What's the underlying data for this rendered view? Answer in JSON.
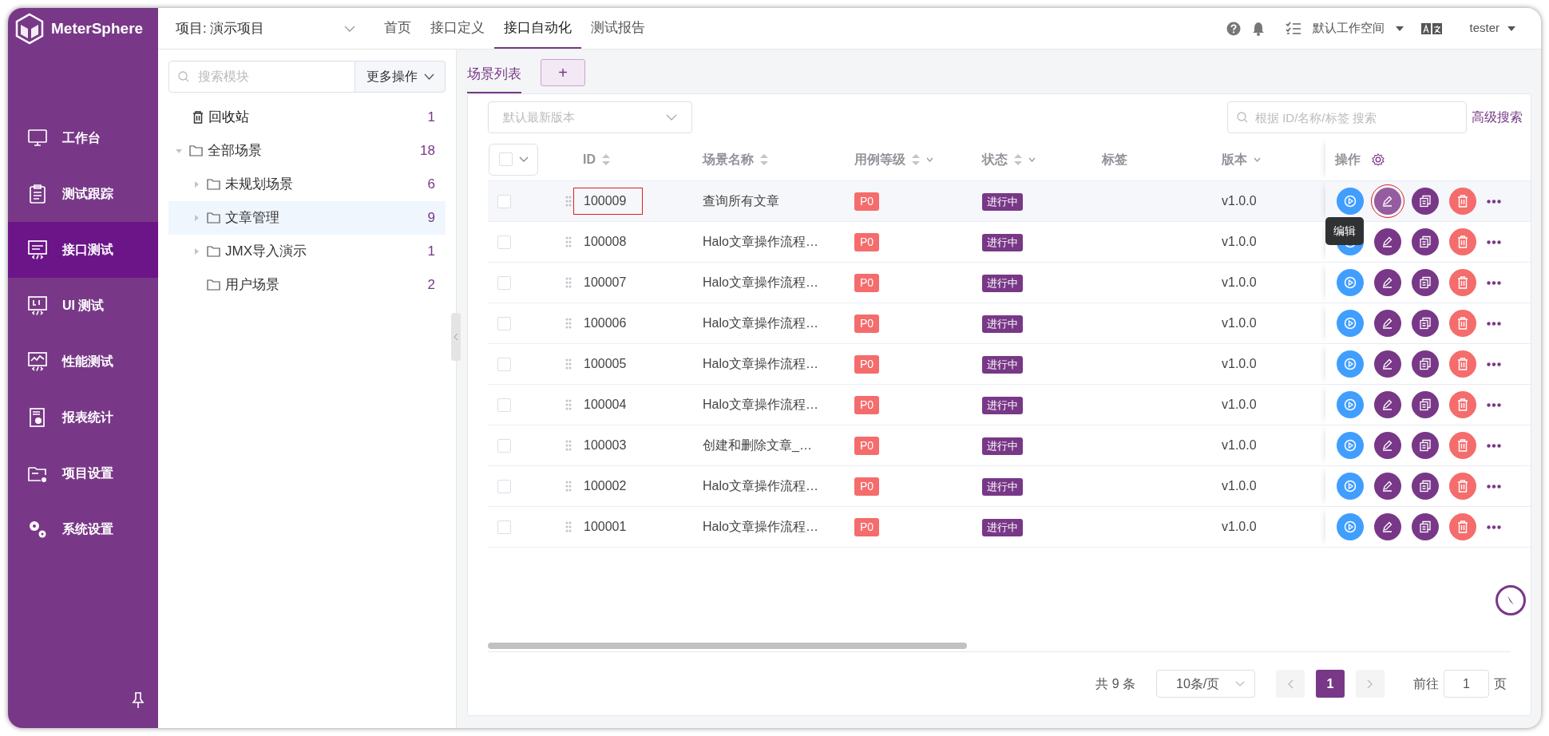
{
  "sidebar": {
    "logo": "MeterSphere",
    "items": [
      {
        "label": "工作台",
        "selected": false
      },
      {
        "label": "测试跟踪",
        "selected": false
      },
      {
        "label": "接口测试",
        "selected": true
      },
      {
        "label": "UI 测试",
        "selected": false
      },
      {
        "label": "性能测试",
        "selected": false
      },
      {
        "label": "报表统计",
        "selected": false
      },
      {
        "label": "项目设置",
        "selected": false
      },
      {
        "label": "系统设置",
        "selected": false
      }
    ]
  },
  "header": {
    "project": "项目: 演示项目",
    "nav": [
      {
        "label": "首页",
        "selected": false
      },
      {
        "label": "接口定义",
        "selected": false
      },
      {
        "label": "接口自动化",
        "selected": true
      },
      {
        "label": "测试报告",
        "selected": false
      }
    ],
    "workspace": "默认工作空间",
    "user": "tester"
  },
  "module_tree": {
    "search_placeholder": "搜索模块",
    "more_button": "更多操作",
    "trash": {
      "label": "回收站",
      "count": "1"
    },
    "nodes": [
      {
        "label": "全部场景",
        "count": "18",
        "expanded": true,
        "selected": false,
        "children": [
          {
            "label": "未规划场景",
            "count": "6",
            "expanded": false,
            "selected": false
          },
          {
            "label": "文章管理",
            "count": "9",
            "expanded": false,
            "selected": true
          },
          {
            "label": "JMX导入演示",
            "count": "1",
            "expanded": false,
            "selected": false
          },
          {
            "label": "用户场景",
            "count": "2",
            "selected": false
          }
        ]
      }
    ]
  },
  "tabs": [
    {
      "label": "场景列表",
      "selected": true
    }
  ],
  "add_tab_button": "+",
  "toolbar": {
    "version_placeholder": "默认最新版本",
    "search_placeholder": "根据 ID/名称/标签 搜索",
    "advanced_search": "高级搜索"
  },
  "table": {
    "select_all": {
      "checked": false
    },
    "columns": [
      {
        "label": "ID",
        "sortable": true,
        "filterable": false
      },
      {
        "label": "场景名称",
        "sortable": true,
        "filterable": false
      },
      {
        "label": "用例等级",
        "sortable": true,
        "filterable": true
      },
      {
        "label": "状态",
        "sortable": true,
        "filterable": true
      },
      {
        "label": "标签",
        "sortable": false,
        "filterable": false
      },
      {
        "label": "版本",
        "sortable": false,
        "filterable": true
      },
      {
        "label": "操作",
        "sortable": false,
        "filterable": false
      }
    ],
    "rows": [
      {
        "checked": false,
        "id": "100009",
        "name": "查询所有文章",
        "level": "P0",
        "status": "进行中",
        "version": "v1.0.0",
        "hovered": true,
        "id_marked": true,
        "edit_marked": true,
        "tooltip": "编辑"
      },
      {
        "checked": false,
        "id": "100008",
        "name": "Halo文章操作流程…",
        "level": "P0",
        "status": "进行中",
        "version": "v1.0.0",
        "hovered": false,
        "id_marked": false,
        "edit_marked": false
      },
      {
        "checked": false,
        "id": "100007",
        "name": "Halo文章操作流程…",
        "level": "P0",
        "status": "进行中",
        "version": "v1.0.0",
        "hovered": false,
        "id_marked": false,
        "edit_marked": false
      },
      {
        "checked": false,
        "id": "100006",
        "name": "Halo文章操作流程…",
        "level": "P0",
        "status": "进行中",
        "version": "v1.0.0",
        "hovered": false,
        "id_marked": false,
        "edit_marked": false
      },
      {
        "checked": false,
        "id": "100005",
        "name": "Halo文章操作流程…",
        "level": "P0",
        "status": "进行中",
        "version": "v1.0.0",
        "hovered": false,
        "id_marked": false,
        "edit_marked": false
      },
      {
        "checked": false,
        "id": "100004",
        "name": "Halo文章操作流程…",
        "level": "P0",
        "status": "进行中",
        "version": "v1.0.0",
        "hovered": false,
        "id_marked": false,
        "edit_marked": false
      },
      {
        "checked": false,
        "id": "100003",
        "name": "创建和删除文章_…",
        "level": "P0",
        "status": "进行中",
        "version": "v1.0.0",
        "hovered": false,
        "id_marked": false,
        "edit_marked": false
      },
      {
        "checked": false,
        "id": "100002",
        "name": "Halo文章操作流程…",
        "level": "P0",
        "status": "进行中",
        "version": "v1.0.0",
        "hovered": false,
        "id_marked": false,
        "edit_marked": false
      },
      {
        "checked": false,
        "id": "100001",
        "name": "Halo文章操作流程…",
        "level": "P0",
        "status": "进行中",
        "version": "v1.0.0",
        "hovered": false,
        "id_marked": false,
        "edit_marked": false
      }
    ]
  },
  "pagination": {
    "total": "共 9 条",
    "page_size": "10条/页",
    "pages": [
      {
        "label": "1",
        "selected": true
      }
    ],
    "goto_label": "前往",
    "goto_value": "1",
    "goto_suffix": "页"
  }
}
